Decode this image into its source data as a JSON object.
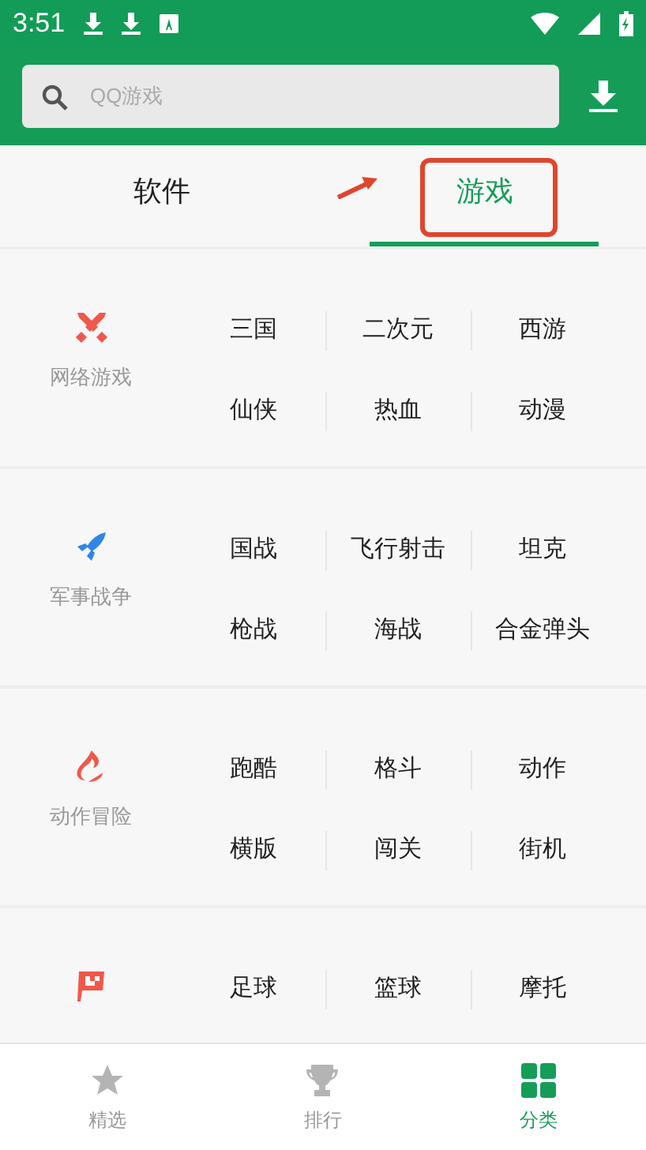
{
  "status_bar": {
    "time": "3:51"
  },
  "search": {
    "placeholder": "QQ游戏"
  },
  "tabs": [
    {
      "label": "软件",
      "selected": false
    },
    {
      "label": "游戏",
      "selected": true
    }
  ],
  "categories": [
    {
      "kind": "swords",
      "name": "网络游戏",
      "color": "#f0584a",
      "tags": [
        "三国",
        "二次元",
        "西游",
        "仙侠",
        "热血",
        "动漫"
      ]
    },
    {
      "kind": "rocket",
      "name": "军事战争",
      "color": "#2f86e8",
      "tags": [
        "国战",
        "飞行射击",
        "坦克",
        "枪战",
        "海战",
        "合金弹头"
      ]
    },
    {
      "kind": "fire",
      "name": "动作冒险",
      "color": "#f0584a",
      "tags": [
        "跑酷",
        "格斗",
        "动作",
        "横版",
        "闯关",
        "街机"
      ]
    },
    {
      "kind": "flag",
      "color": "#f0584a",
      "tags": [
        "足球",
        "篮球",
        "摩托"
      ]
    }
  ],
  "bottom_nav": [
    {
      "kind": "star",
      "label": "精选",
      "selected": false
    },
    {
      "kind": "trophy",
      "label": "排行",
      "selected": false
    },
    {
      "kind": "grid",
      "label": "分类",
      "selected": true
    }
  ]
}
